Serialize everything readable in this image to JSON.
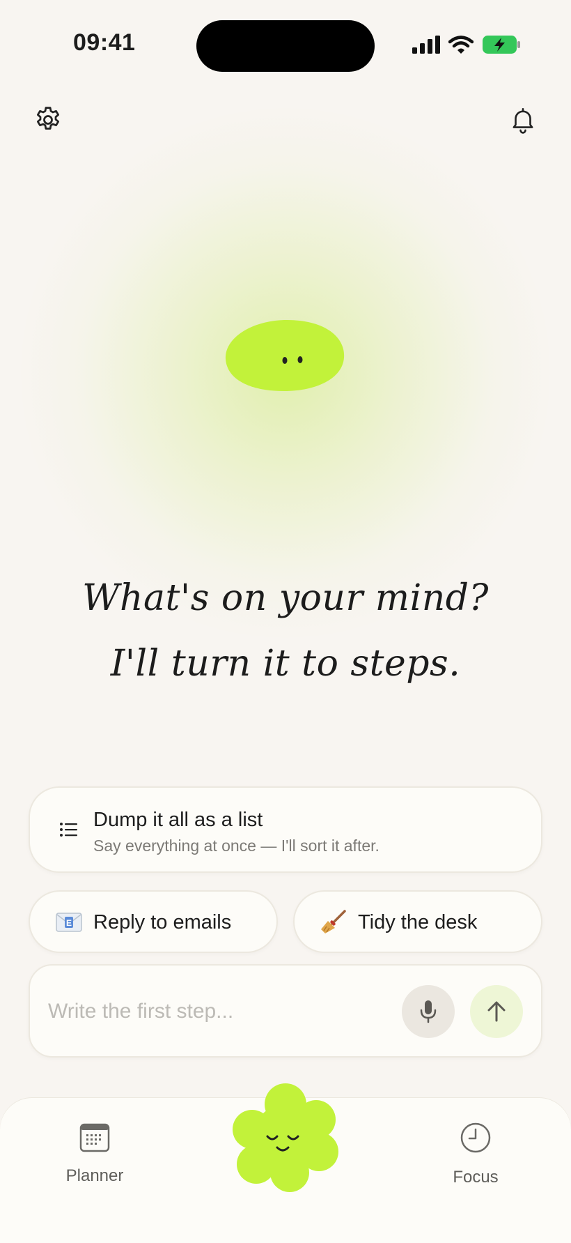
{
  "status_bar": {
    "time": "09:41"
  },
  "header": {
    "settings_icon": "gear-icon",
    "notifications_icon": "bell-icon"
  },
  "prompt": {
    "line1": "What's on your mind?",
    "line2": "I'll turn it to steps."
  },
  "dump_card": {
    "icon": "list-icon",
    "title": "Dump it all as a list",
    "subtitle": "Say everything at once — I'll sort it after."
  },
  "suggestions": [
    {
      "icon": "email-icon",
      "label": "Reply to emails"
    },
    {
      "icon": "broom-icon",
      "label": "Tidy the desk"
    }
  ],
  "composer": {
    "placeholder": "Write the first step...",
    "mic_icon": "microphone-icon",
    "send_icon": "arrow-up-icon"
  },
  "tab_bar": {
    "planner": {
      "label": "Planner",
      "icon": "calendar-icon"
    },
    "center": {
      "icon": "flower-mascot-icon"
    },
    "focus": {
      "label": "Focus",
      "icon": "clock-icon"
    }
  },
  "colors": {
    "accent": "#c2f23a",
    "background": "#f8f5f1",
    "battery": "#34c759"
  }
}
